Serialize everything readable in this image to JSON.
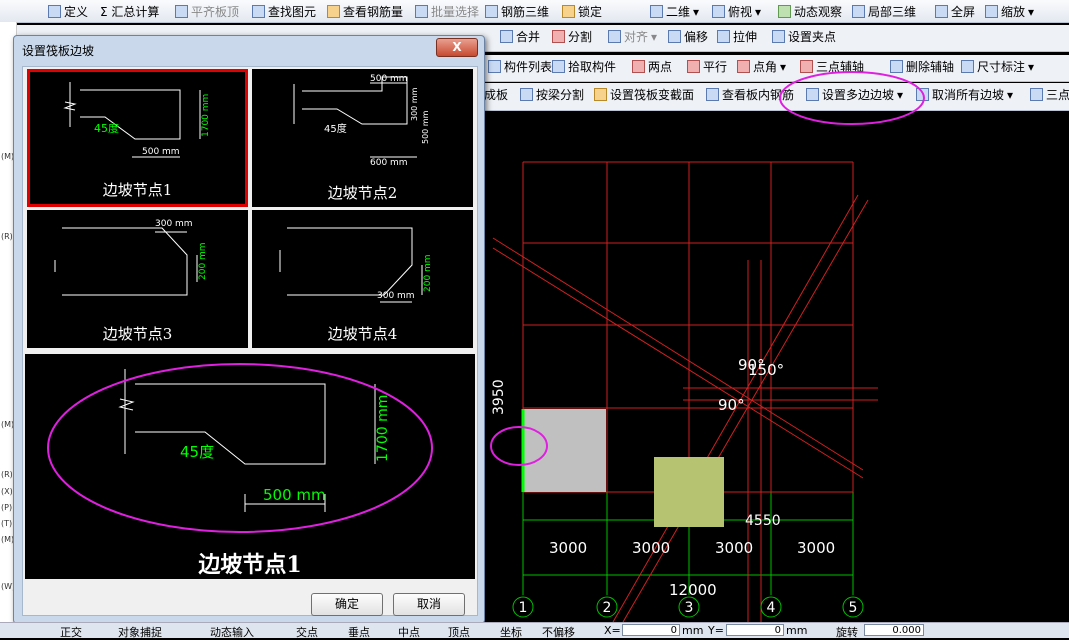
{
  "toolbar1": {
    "items": [
      "定义",
      "Σ 汇总计算",
      "平齐板顶",
      "查找图元",
      "查看钢筋量",
      "批量选择",
      "钢筋三维",
      "锁定",
      "二维",
      "俯视",
      "动态观察",
      "局部三维",
      "全屏",
      "缩放"
    ]
  },
  "toolbar2": {
    "items": [
      "合并",
      "分割",
      "对齐",
      "偏移",
      "拉伸",
      "设置夹点"
    ]
  },
  "toolbar3": {
    "items": [
      "构件列表",
      "拾取构件",
      "两点",
      "平行",
      "点角",
      "三点辅轴",
      "删除辅轴",
      "尺寸标注"
    ]
  },
  "toolbar4": {
    "items": [
      "成板",
      "按梁分割",
      "设置筏板变截面",
      "查看板内钢筋",
      "设置多边边坡",
      "取消所有边坡",
      "三点"
    ]
  },
  "left_strip": [
    "(M)",
    "(R)",
    "(M)",
    "(R)",
    "(X)",
    "(P)",
    "(T)",
    "(M)",
    "(W)"
  ],
  "dialog": {
    "title": "设置筏板边坡",
    "close": "X",
    "thumbs": [
      {
        "label": "边坡节点1",
        "selected": true
      },
      {
        "label": "边坡节点2",
        "selected": false
      },
      {
        "label": "边坡节点3",
        "selected": false
      },
      {
        "label": "边坡节点4",
        "selected": false
      }
    ],
    "thumb_texts": {
      "t1_angle": "45度",
      "t1_h": "1700 mm",
      "t1_w": "500 mm",
      "t2_top": "500 mm",
      "t2_angle": "45度",
      "t2_h1": "300 mm",
      "t2_h2": "500 mm",
      "t2_w": "600 mm",
      "t3_top": "300 mm",
      "t3_h": "200 mm",
      "t4_w": "300 mm",
      "t4_h": "200 mm"
    },
    "preview": {
      "label": "边坡节点1",
      "angle": "45度",
      "height": "1700 mm",
      "width": "500 mm"
    },
    "ok": "确定",
    "cancel": "取消"
  },
  "canvas": {
    "angles": [
      "90°",
      "150°",
      "90°"
    ],
    "left_dim": "3950",
    "right_dim": "4550",
    "bays": [
      "3000",
      "3000",
      "3000",
      "3000"
    ],
    "total": "12000",
    "axes": [
      "1",
      "2",
      "3",
      "4",
      "5"
    ]
  },
  "status": {
    "items": [
      "正交",
      "对象捕捉",
      "动态输入",
      "交点",
      "垂点",
      "中点",
      "顶点",
      "坐标",
      "不偏移"
    ],
    "x_label": "X=",
    "x_value": "0",
    "unit": "mm",
    "y_label": "Y=",
    "y_value": "0",
    "unit2": "mm",
    "rotate_label": "旋转",
    "rotate_value": "0.000"
  }
}
